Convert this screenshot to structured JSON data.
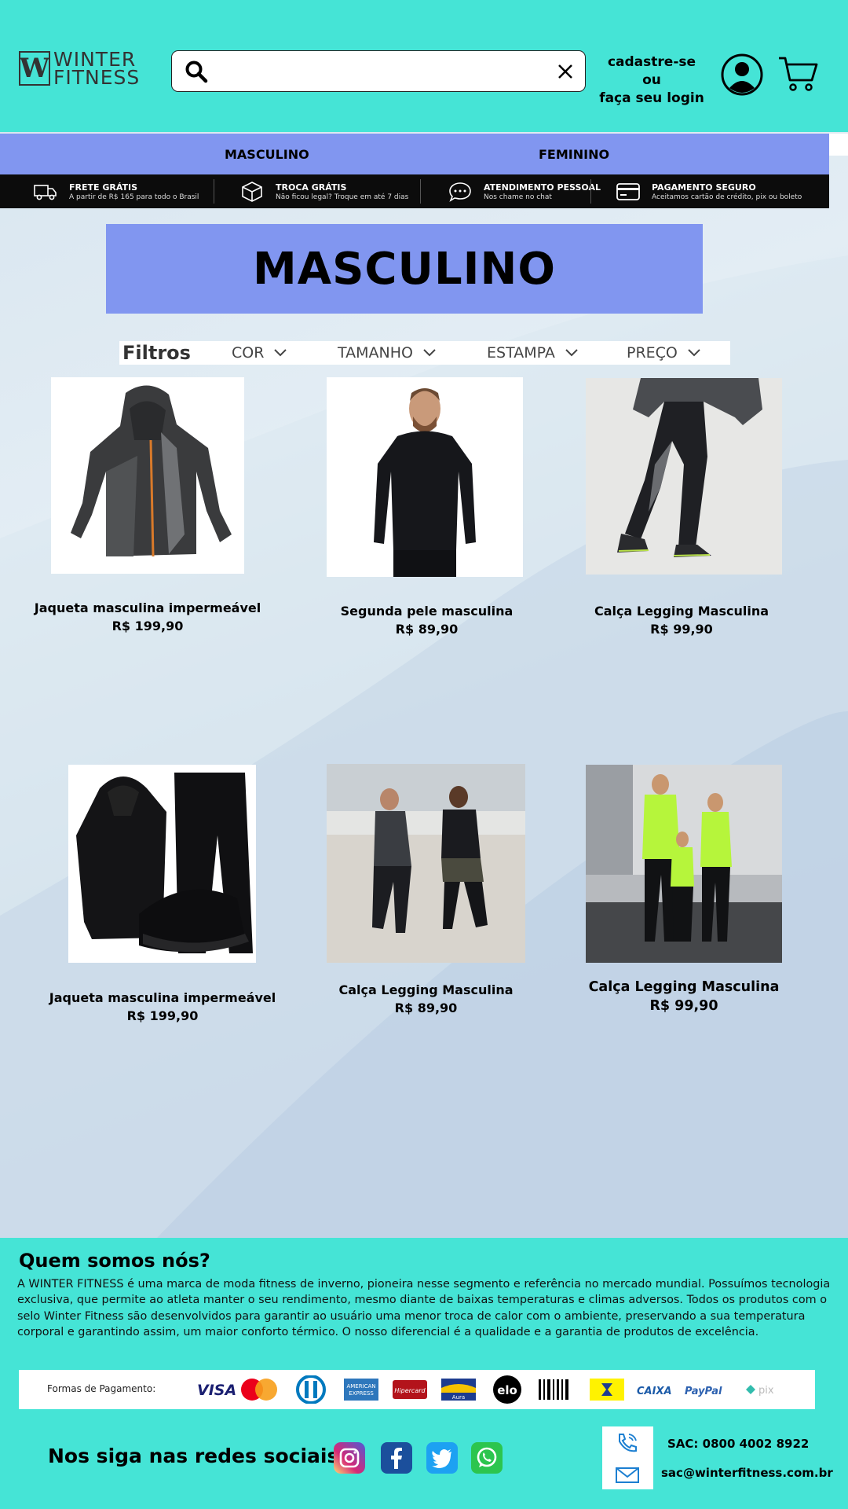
{
  "header": {
    "logo_mark": "W",
    "logo_line1": "WINTER",
    "logo_line2": "FITNESS",
    "search_value": "",
    "login_line1": "cadastre-se ou",
    "login_line2": "faça seu login"
  },
  "nav": {
    "items": [
      {
        "label": "MASCULINO"
      },
      {
        "label": "FEMININO"
      }
    ]
  },
  "benefits": [
    {
      "title": "FRETE GRÁTIS",
      "subtitle": "A partir de R$ 165 para todo o Brasil",
      "icon": "truck-icon"
    },
    {
      "title": "TROCA GRÁTIS",
      "subtitle": "Não ficou legal? Troque em até 7 dias",
      "icon": "box-icon"
    },
    {
      "title": "ATENDIMENTO PESSOAL",
      "subtitle": "Nos chame no chat",
      "icon": "chat-icon"
    },
    {
      "title": "PAGAMENTO SEGURO",
      "subtitle": "Aceitamos cartão de crédito, pix ou boleto",
      "icon": "card-icon"
    }
  ],
  "page_title": "MASCULINO",
  "filters": {
    "label": "Filtros",
    "items": [
      {
        "label": "COR"
      },
      {
        "label": "TAMANHO"
      },
      {
        "label": "ESTAMPA"
      },
      {
        "label": "PREÇO"
      }
    ]
  },
  "products": [
    {
      "name": "Jaqueta masculina impermeável",
      "price": "R$ 199,90"
    },
    {
      "name": "Segunda pele  masculina",
      "price": "R$ 89,90"
    },
    {
      "name": "Calça Legging Masculina",
      "price": "R$ 99,90"
    },
    {
      "name": "Jaqueta masculina impermeável",
      "price": "R$ 199,90"
    },
    {
      "name": "Calça Legging Masculina",
      "price": "R$ 89,90"
    },
    {
      "name": "Calça Legging Masculina",
      "price": "R$ 99,90"
    }
  ],
  "footer": {
    "about_title": "Quem somos nós?",
    "about_text": "A WINTER FITNESS é uma marca de moda fitness de inverno, pioneira nesse segmento e referência no mercado mundial. Possuímos tecnologia exclusiva, que permite ao atleta manter o seu rendimento, mesmo diante de baixas temperaturas e climas adversos. Todos os produtos com o selo Winter Fitness são desenvolvidos para garantir ao usuário uma menor troca de calor com o ambiente, preservando a sua temperatura corporal e garantindo assim, um maior conforto térmico. O nosso diferencial é a qualidade e a garantia de produtos de excelência.",
    "payments_label": "Formas de Pagamento:",
    "payment_logos": {
      "visa": "VISA",
      "amex_line1": "AMERICAN",
      "amex_line2": "EXPRESS",
      "hipercard": "Hipercard",
      "aura": "Aura",
      "elo": "elo",
      "caixa": "CAIXA",
      "paypal": "PayPal",
      "pix": "pix"
    },
    "social_title": "Nos siga nas redes sociais:",
    "sac": "SAC: 0800 4002 8922",
    "email": "sac@winterfitness.com.br"
  },
  "colors": {
    "header_bg": "#45e4d6",
    "nav_bg": "#8196f0",
    "benefits_bg": "#0c0c0c"
  }
}
